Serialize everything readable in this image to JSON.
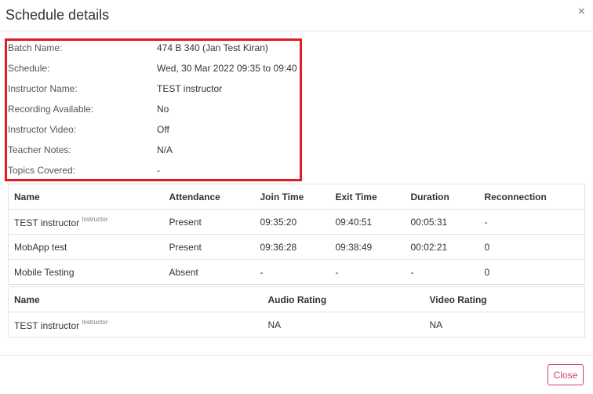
{
  "modal": {
    "title": "Schedule details",
    "close_icon": "×",
    "close_button_label": "Close",
    "highlight_color": "#e01b22",
    "accent_color": "#d9386b"
  },
  "details": [
    {
      "label": "Batch Name:",
      "value": "474 B 340 (Jan Test Kiran)"
    },
    {
      "label": "Schedule:",
      "value": "Wed, 30 Mar 2022 09:35 to 09:40"
    },
    {
      "label": "Instructor Name:",
      "value": "TEST instructor"
    },
    {
      "label": "Recording Available:",
      "value": "No"
    },
    {
      "label": "Instructor Video:",
      "value": "Off"
    },
    {
      "label": "Teacher Notes:",
      "value": "N/A"
    },
    {
      "label": "Topics Covered:",
      "value": "-"
    }
  ],
  "attendance_table": {
    "headers": [
      "Name",
      "Attendance",
      "Join Time",
      "Exit Time",
      "Duration",
      "Reconnection"
    ],
    "rows": [
      {
        "name": "TEST instructor",
        "role": "Instructor",
        "attendance": "Present",
        "join": "09:35:20",
        "exit": "09:40:51",
        "duration": "00:05:31",
        "reconnection": "-"
      },
      {
        "name": "MobApp test",
        "role": "",
        "attendance": "Present",
        "join": "09:36:28",
        "exit": "09:38:49",
        "duration": "00:02:21",
        "reconnection": "0"
      },
      {
        "name": "Mobile Testing",
        "role": "",
        "attendance": "Absent",
        "join": "-",
        "exit": "-",
        "duration": "-",
        "reconnection": "0"
      }
    ]
  },
  "rating_table": {
    "headers": [
      "Name",
      "Audio Rating",
      "Video Rating"
    ],
    "rows": [
      {
        "name": "TEST instructor",
        "role": "Instructor",
        "audio": "NA",
        "video": "NA"
      }
    ]
  }
}
